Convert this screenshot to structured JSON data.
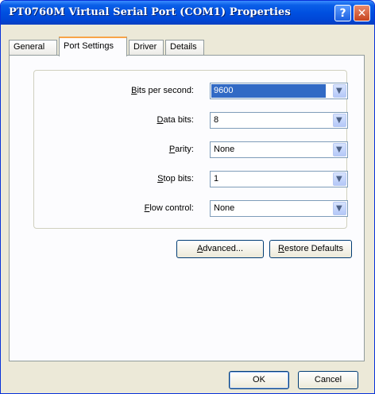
{
  "window": {
    "title": "PT0760M Virtual Serial Port (COM1) Properties"
  },
  "titlebar": {
    "help_glyph": "?",
    "close_glyph": "✕"
  },
  "tabs": [
    {
      "label": "General"
    },
    {
      "label": "Port Settings"
    },
    {
      "label": "Driver"
    },
    {
      "label": "Details"
    }
  ],
  "fields": [
    {
      "label_ul": "B",
      "label_rest": "its per second:",
      "value": "9600"
    },
    {
      "label_ul": "D",
      "label_rest": "ata bits:",
      "value": "8"
    },
    {
      "label_pre": "",
      "label_ul": "P",
      "label_rest": "arity:",
      "value": "None"
    },
    {
      "label_ul": "S",
      "label_rest": "top bits:",
      "value": "1"
    },
    {
      "label_ul": "F",
      "label_rest": "low control:",
      "value": "None"
    }
  ],
  "buttons": {
    "advanced_ul": "A",
    "advanced_rest": "dvanced...",
    "restore_ul": "R",
    "restore_rest": "estore Defaults",
    "ok": "OK",
    "cancel": "Cancel"
  },
  "dropdown_glyph": "▼"
}
